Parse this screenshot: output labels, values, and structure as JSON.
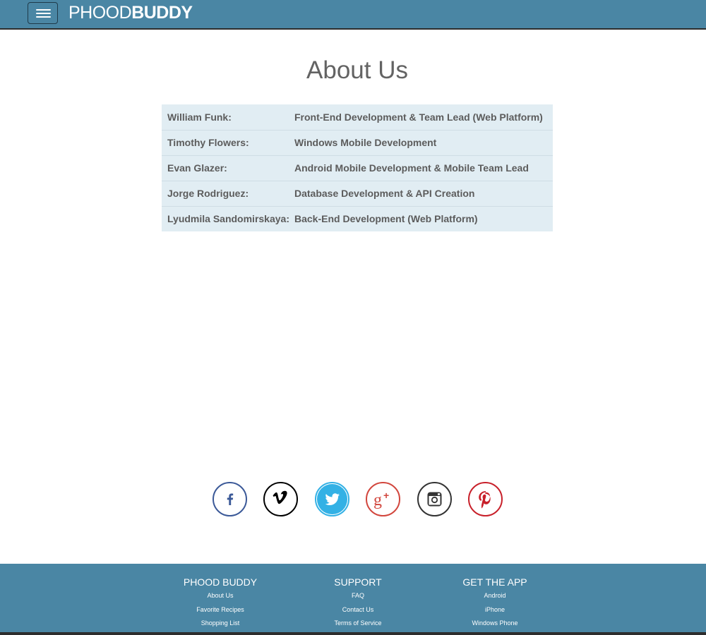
{
  "header": {
    "brand_light": "PHOOD",
    "brand_bold": "BUDDY"
  },
  "page": {
    "title": "About Us"
  },
  "team": [
    {
      "name": "William Funk:",
      "role": "Front-End Development & Team Lead (Web Platform)"
    },
    {
      "name": "Timothy Flowers:",
      "role": "Windows Mobile Development"
    },
    {
      "name": "Evan Glazer:",
      "role": "Android Mobile Development & Mobile Team Lead"
    },
    {
      "name": "Jorge Rodriguez:",
      "role": "Database Development & API Creation"
    },
    {
      "name": "Lyudmila Sandomirskaya:",
      "role": "Back-End Development (Web Platform)"
    }
  ],
  "social": [
    {
      "name": "facebook-icon",
      "color": "#3b5998"
    },
    {
      "name": "vimeo-icon",
      "color": "#000000"
    },
    {
      "name": "twitter-icon",
      "color": "#33b1e5"
    },
    {
      "name": "google-plus-icon",
      "color": "#d2463d"
    },
    {
      "name": "instagram-icon",
      "color": "#333333"
    },
    {
      "name": "pinterest-icon",
      "color": "#c8202a"
    }
  ],
  "footer": {
    "col1": {
      "heading": "PHOOD BUDDY",
      "links": [
        "About Us",
        "Favorite Recipes",
        "Shopping List"
      ]
    },
    "col2": {
      "heading": "SUPPORT",
      "links": [
        "FAQ",
        "Contact Us",
        "Terms of Service"
      ]
    },
    "col3": {
      "heading": "GET THE APP",
      "links": [
        "Android",
        "iPhone",
        "Windows Phone"
      ]
    }
  },
  "colors": {
    "header_bg": "#4a86a4",
    "table_bg": "#e1edf3",
    "text_gray": "#5c5c5c"
  }
}
